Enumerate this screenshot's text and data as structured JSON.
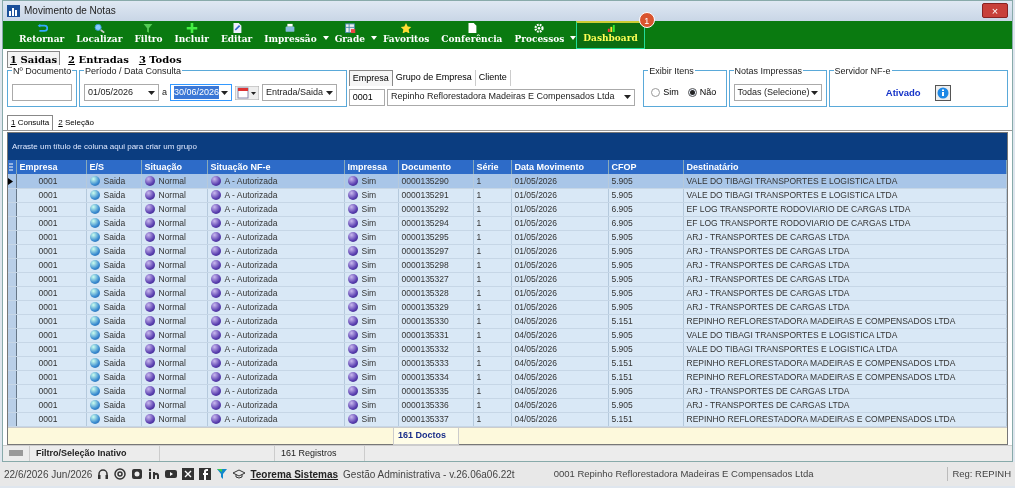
{
  "window": {
    "title": "Movimento de Notas",
    "close": "×"
  },
  "toolbar": [
    {
      "label": "Retornar",
      "dropdown": false,
      "selected": false
    },
    {
      "label": "Localizar",
      "dropdown": false,
      "selected": false
    },
    {
      "label": "Filtro",
      "dropdown": false,
      "selected": false
    },
    {
      "label": "Incluir",
      "dropdown": false,
      "selected": false
    },
    {
      "label": "Editar",
      "dropdown": false,
      "selected": false
    },
    {
      "label": "Impressão",
      "dropdown": true,
      "selected": false
    },
    {
      "label": "Grade",
      "dropdown": true,
      "selected": false
    },
    {
      "label": "Favoritos",
      "dropdown": false,
      "selected": false
    },
    {
      "label": "Conferência",
      "dropdown": false,
      "selected": false
    },
    {
      "label": "Processos",
      "dropdown": true,
      "selected": false
    },
    {
      "label": "Dashboard",
      "dropdown": false,
      "selected": true,
      "badge": "1"
    }
  ],
  "tabs": [
    {
      "key": "1",
      "label": "Saidas",
      "selected": true
    },
    {
      "key": "2",
      "label": "Entradas",
      "selected": false
    },
    {
      "key": "3",
      "label": "Todos",
      "selected": false
    }
  ],
  "filters": {
    "documento": {
      "legend": "Nº Documento"
    },
    "periodo": {
      "legend": "Período / Data Consulta",
      "from": "01/05/2026",
      "separator": "a",
      "to": "30/06/2026",
      "type": "Entrada/Saida"
    },
    "empresa_tabs": [
      {
        "label": "Empresa",
        "selected": true
      },
      {
        "label": "Grupo de Empresa",
        "selected": false
      },
      {
        "label": "Cliente",
        "selected": false
      }
    ],
    "empresa_code": "0001",
    "empresa_name": "Repinho Reflorestadora Madeiras E Compensados Ltda",
    "exibir_itens": {
      "legend": "Exibir Itens",
      "options": [
        {
          "label": "Sim",
          "selected": false
        },
        {
          "label": "Não",
          "selected": true
        }
      ]
    },
    "notas_impressas": {
      "legend": "Notas Impressas",
      "value": "Todas (Selecione)"
    },
    "servidor": {
      "legend": "Servidor NF-e",
      "status": "Ativado"
    }
  },
  "subtabs": [
    {
      "key": "1",
      "label": "Consulta",
      "selected": true
    },
    {
      "key": "2",
      "label": "Seleção",
      "selected": false
    }
  ],
  "grid": {
    "group_hint": "Arraste um título de coluna aqui para criar um grupo",
    "columns": [
      "Empresa",
      "E/S",
      "Situação",
      "Situação NF-e",
      "Impressa",
      "Documento",
      "Série",
      "Data Movimento",
      "CFOP",
      "Destinatário"
    ],
    "rows": [
      {
        "selected": true,
        "cells": [
          "0001",
          "Saida",
          "Normal",
          "A - Autorizada",
          "Sim",
          "0000135290",
          "1",
          "01/05/2026",
          "5.905",
          "VALE DO TIBAGI TRANSPORTES E LOGISTICA LTDA"
        ]
      },
      {
        "selected": false,
        "cells": [
          "0001",
          "Saida",
          "Normal",
          "A - Autorizada",
          "Sim",
          "0000135291",
          "1",
          "01/05/2026",
          "5.905",
          "VALE DO TIBAGI TRANSPORTES E LOGISTICA LTDA"
        ]
      },
      {
        "selected": false,
        "cells": [
          "0001",
          "Saida",
          "Normal",
          "A - Autorizada",
          "Sim",
          "0000135292",
          "1",
          "01/05/2026",
          "6.905",
          "EF LOG TRANSPORTE RODOVIARIO DE CARGAS LTDA"
        ]
      },
      {
        "selected": false,
        "cells": [
          "0001",
          "Saida",
          "Normal",
          "A - Autorizada",
          "Sim",
          "0000135294",
          "1",
          "01/05/2026",
          "6.905",
          "EF LOG TRANSPORTE RODOVIARIO DE CARGAS LTDA"
        ]
      },
      {
        "selected": false,
        "cells": [
          "0001",
          "Saida",
          "Normal",
          "A - Autorizada",
          "Sim",
          "0000135295",
          "1",
          "01/05/2026",
          "5.905",
          "ARJ - TRANSPORTES DE CARGAS LTDA"
        ]
      },
      {
        "selected": false,
        "cells": [
          "0001",
          "Saida",
          "Normal",
          "A - Autorizada",
          "Sim",
          "0000135297",
          "1",
          "01/05/2026",
          "5.905",
          "ARJ - TRANSPORTES DE CARGAS LTDA"
        ]
      },
      {
        "selected": false,
        "cells": [
          "0001",
          "Saida",
          "Normal",
          "A - Autorizada",
          "Sim",
          "0000135298",
          "1",
          "01/05/2026",
          "5.905",
          "ARJ - TRANSPORTES DE CARGAS LTDA"
        ]
      },
      {
        "selected": false,
        "cells": [
          "0001",
          "Saida",
          "Normal",
          "A - Autorizada",
          "Sim",
          "0000135327",
          "1",
          "01/05/2026",
          "5.905",
          "ARJ - TRANSPORTES DE CARGAS LTDA"
        ]
      },
      {
        "selected": false,
        "cells": [
          "0001",
          "Saida",
          "Normal",
          "A - Autorizada",
          "Sim",
          "0000135328",
          "1",
          "01/05/2026",
          "5.905",
          "ARJ - TRANSPORTES DE CARGAS LTDA"
        ]
      },
      {
        "selected": false,
        "cells": [
          "0001",
          "Saida",
          "Normal",
          "A - Autorizada",
          "Sim",
          "0000135329",
          "1",
          "01/05/2026",
          "5.905",
          "ARJ - TRANSPORTES DE CARGAS LTDA"
        ]
      },
      {
        "selected": false,
        "cells": [
          "0001",
          "Saida",
          "Normal",
          "A - Autorizada",
          "Sim",
          "0000135330",
          "1",
          "04/05/2026",
          "5.151",
          "REPINHO REFLORESTADORA MADEIRAS E COMPENSADOS LTDA"
        ]
      },
      {
        "selected": false,
        "cells": [
          "0001",
          "Saida",
          "Normal",
          "A - Autorizada",
          "Sim",
          "0000135331",
          "1",
          "04/05/2026",
          "5.905",
          "VALE DO TIBAGI TRANSPORTES E LOGISTICA LTDA"
        ]
      },
      {
        "selected": false,
        "cells": [
          "0001",
          "Saida",
          "Normal",
          "A - Autorizada",
          "Sim",
          "0000135332",
          "1",
          "04/05/2026",
          "5.905",
          "VALE DO TIBAGI TRANSPORTES E LOGISTICA LTDA"
        ]
      },
      {
        "selected": false,
        "cells": [
          "0001",
          "Saida",
          "Normal",
          "A - Autorizada",
          "Sim",
          "0000135333",
          "1",
          "04/05/2026",
          "5.151",
          "REPINHO REFLORESTADORA MADEIRAS E COMPENSADOS LTDA"
        ]
      },
      {
        "selected": false,
        "cells": [
          "0001",
          "Saida",
          "Normal",
          "A - Autorizada",
          "Sim",
          "0000135334",
          "1",
          "04/05/2026",
          "5.151",
          "REPINHO REFLORESTADORA MADEIRAS E COMPENSADOS LTDA"
        ]
      },
      {
        "selected": false,
        "cells": [
          "0001",
          "Saida",
          "Normal",
          "A - Autorizada",
          "Sim",
          "0000135335",
          "1",
          "04/05/2026",
          "5.905",
          "ARJ - TRANSPORTES DE CARGAS LTDA"
        ]
      },
      {
        "selected": false,
        "cells": [
          "0001",
          "Saida",
          "Normal",
          "A - Autorizada",
          "Sim",
          "0000135336",
          "1",
          "04/05/2026",
          "5.905",
          "ARJ - TRANSPORTES DE CARGAS LTDA"
        ]
      },
      {
        "selected": false,
        "cells": [
          "0001",
          "Saida",
          "Normal",
          "A - Autorizada",
          "Sim",
          "0000135337",
          "1",
          "04/05/2026",
          "5.151",
          "REPINHO REFLORESTADORA MADEIRAS E COMPENSADOS LTDA"
        ]
      }
    ],
    "footer": "161 Doctos"
  },
  "status": {
    "filter": "Filtro/Seleção Inativo",
    "records": "161 Registros"
  },
  "bottom_bar": {
    "date": "22/6/2026 Jun/2026",
    "link": "Teorema Sistemas",
    "version": "Gestão Administrativa - v.26.06a06.22t",
    "company": "0001 Repinho Reflorestadora Madeiras E Compensados Ltda",
    "reg": "Reg: REPINH"
  }
}
